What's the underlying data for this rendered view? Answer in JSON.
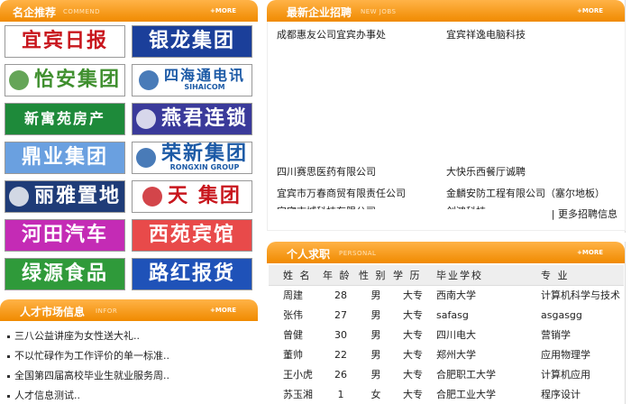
{
  "logos_panel": {
    "title": "名企推荐",
    "subtitle": "COMMEND",
    "more": "+MORE",
    "logos": [
      {
        "text": "宜宾日报",
        "small": "",
        "bg": "#ffffff",
        "fg": "#c8161d",
        "icon": ""
      },
      {
        "text": "银龙集团",
        "small": "",
        "bg": "#1b3f9a",
        "fg": "#ffffff",
        "icon": ""
      },
      {
        "text": "怡安集团",
        "small": "",
        "bg": "#ffffff",
        "fg": "#3f8f2e",
        "icon": "yian-logo-icon"
      },
      {
        "text": "四海通电讯",
        "small": "SIHAICOM",
        "bg": "#ffffff",
        "fg": "#1c5aa6",
        "icon": "sihaitong-logo-icon"
      },
      {
        "text": "新寓苑房产",
        "small": "",
        "bg": "#1e8a3a",
        "fg": "#ffffff",
        "icon": ""
      },
      {
        "text": "燕君连锁",
        "small": "",
        "bg": "#3a3a9a",
        "fg": "#ffffff",
        "icon": "yanjun-logo-icon"
      },
      {
        "text": "鼎业集团",
        "small": "",
        "bg": "#6aa0e0",
        "fg": "#ffffff",
        "icon": ""
      },
      {
        "text": "荣新集团",
        "small": "RONGXIN GROUP",
        "bg": "#ffffff",
        "fg": "#1c5aa6",
        "icon": "rongxin-logo-icon"
      },
      {
        "text": "丽雅置地",
        "small": "",
        "bg": "#1f3c78",
        "fg": "#ffffff",
        "icon": "liya-logo-icon"
      },
      {
        "text": "天 集团",
        "small": "",
        "bg": "#ffffff",
        "fg": "#c8161d",
        "icon": "tian-logo-icon"
      },
      {
        "text": "河田汽车",
        "small": "",
        "bg": "#c42bb5",
        "fg": "#ffffff",
        "icon": ""
      },
      {
        "text": "西苑宾馆",
        "small": "",
        "bg": "#e84a4a",
        "fg": "#ffffff",
        "icon": ""
      },
      {
        "text": "绿源食品",
        "small": "",
        "bg": "#2f9a3a",
        "fg": "#ffffff",
        "icon": ""
      },
      {
        "text": "路红报货",
        "small": "",
        "bg": "#1f52b8",
        "fg": "#ffffff",
        "icon": ""
      }
    ]
  },
  "talent_panel": {
    "title": "人才市场信息",
    "subtitle": "INFOR",
    "more": "+MORE",
    "items": [
      "三八公益讲座为女性送大礼..",
      "不以忙碌作为工作评价的单一标准..",
      "全国第四届高校毕业生就业服务周..",
      "人才信息测试.."
    ]
  },
  "jobs_panel": {
    "title": "最新企业招聘",
    "subtitle": "NEW JOBS",
    "more": "+MORE",
    "jobs_top": [
      "成都惠友公司宜宾办事处",
      "宜宾祥逸电脑科技"
    ],
    "jobs_bottom": [
      "四川赛思医药有限公司",
      "大快乐西餐厅诚聘",
      "宜宾市万春商贸有限责任公司",
      "金麟安防工程有限公司（塞尔地板）",
      "宜宾市城科技有限公司",
      "创鸿科技"
    ],
    "more_jobs": "| 更多招聘信息"
  },
  "seekers_panel": {
    "title": "个人求职",
    "subtitle": "PERSONAL",
    "more": "+MORE",
    "columns": [
      "姓 名",
      "年 龄",
      "性 别",
      "学 历",
      "毕业学校",
      "专 业"
    ],
    "rows": [
      [
        "周建",
        "28",
        "男",
        "大专",
        "西南大学",
        "计算机科学与技术"
      ],
      [
        "张伟",
        "27",
        "男",
        "大专",
        "safasg",
        "asgasgg"
      ],
      [
        "曾健",
        "30",
        "男",
        "大专",
        "四川电大",
        "营销学"
      ],
      [
        "董帅",
        "22",
        "男",
        "大专",
        "郑州大学",
        "应用物理学"
      ],
      [
        "王小虎",
        "26",
        "男",
        "大专",
        "合肥职工大学",
        "计算机应用"
      ],
      [
        "苏玉湘",
        "1",
        "女",
        "大专",
        "合肥工业大学",
        "程序设计"
      ]
    ]
  }
}
